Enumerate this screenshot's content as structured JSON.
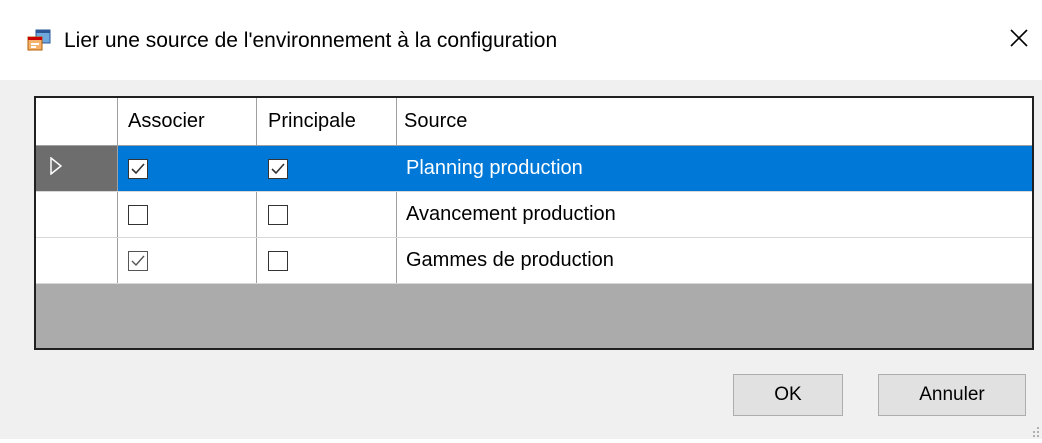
{
  "window": {
    "title": "Lier une source de l'environnement à la configuration",
    "close_glyph": "✕"
  },
  "grid": {
    "columns": [
      "Associer",
      "Principale",
      "Source"
    ],
    "rows": [
      {
        "associer": true,
        "principale": true,
        "source": "Planning production",
        "selected": true
      },
      {
        "associer": false,
        "principale": false,
        "source": "Avancement production",
        "selected": false
      },
      {
        "associer": true,
        "principale": false,
        "source": "Gammes de production",
        "selected": false
      }
    ]
  },
  "buttons": {
    "ok": "OK",
    "cancel": "Annuler"
  },
  "colors": {
    "selection": "#0078d7",
    "grid_background": "#ababab",
    "dialog_background": "#f0f0f0"
  }
}
